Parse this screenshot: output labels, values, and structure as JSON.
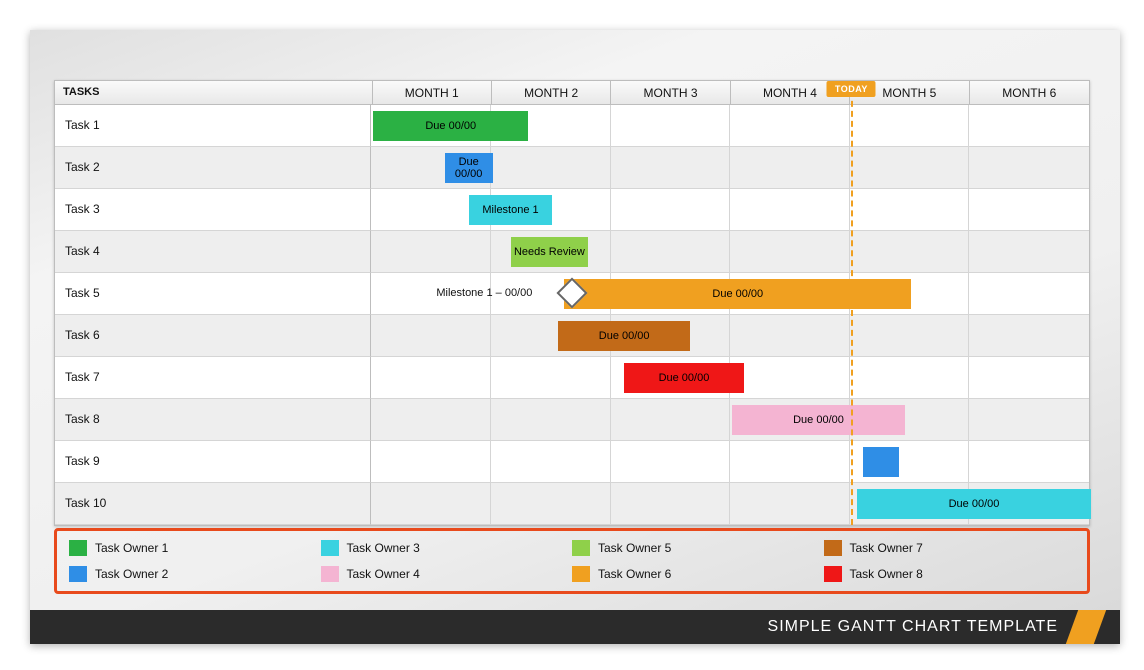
{
  "chart_data": {
    "type": "bar",
    "title": "SIMPLE GANTT CHART TEMPLATE",
    "xlabel": "",
    "ylabel": "",
    "categories": [
      "MONTH 1",
      "MONTH 2",
      "MONTH 3",
      "MONTH 4",
      "MONTH 5",
      "MONTH 6"
    ],
    "xlim": [
      0,
      6
    ],
    "today_position": 4.0,
    "today_label": "TODAY",
    "tasks_header": "TASKS",
    "tasks": [
      {
        "name": "Task 1",
        "start": 0.0,
        "end": 1.3,
        "label": "Due 00/00",
        "color": "#2bb144",
        "owner": "Task Owner 1",
        "prefix": ""
      },
      {
        "name": "Task 2",
        "start": 0.6,
        "end": 1.0,
        "label": "Due 00/00",
        "color": "#2f8ee6",
        "owner": "Task Owner 2",
        "prefix": ""
      },
      {
        "name": "Task 3",
        "start": 0.8,
        "end": 1.5,
        "label": "Milestone 1",
        "color": "#39d2e0",
        "owner": "Task Owner 3",
        "prefix": ""
      },
      {
        "name": "Task 4",
        "start": 1.15,
        "end": 1.8,
        "label": "Needs Review",
        "color": "#8fd04a",
        "owner": "Task Owner 5",
        "prefix": ""
      },
      {
        "name": "Task 5",
        "start": 1.6,
        "end": 4.5,
        "label": "Due 00/00",
        "color": "#f0a020",
        "owner": "Task Owner 6",
        "prefix": "Milestone 1 – 00/00",
        "milestone_at": 1.66
      },
      {
        "name": "Task 6",
        "start": 1.55,
        "end": 2.65,
        "label": "Due 00/00",
        "color": "#c26a18",
        "owner": "Task Owner 7",
        "prefix": ""
      },
      {
        "name": "Task 7",
        "start": 2.1,
        "end": 3.1,
        "label": "Due 00/00",
        "color": "#ef1717",
        "owner": "Task Owner 8",
        "prefix": ""
      },
      {
        "name": "Task 8",
        "start": 3.0,
        "end": 4.45,
        "label": "Due 00/00",
        "color": "#f4b4d2",
        "owner": "Task Owner 4",
        "prefix": ""
      },
      {
        "name": "Task 9",
        "start": 4.1,
        "end": 4.4,
        "label": "",
        "color": "#2f8ee6",
        "owner": "Task Owner 2",
        "prefix": ""
      },
      {
        "name": "Task 10",
        "start": 4.05,
        "end": 6.0,
        "label": "Due 00/00",
        "color": "#39d2e0",
        "owner": "Task Owner 3",
        "prefix": ""
      }
    ],
    "legend": [
      {
        "label": "Task Owner 1",
        "color": "#2bb144"
      },
      {
        "label": "Task Owner 3",
        "color": "#39d2e0"
      },
      {
        "label": "Task Owner 5",
        "color": "#8fd04a"
      },
      {
        "label": "Task Owner 7",
        "color": "#c26a18"
      },
      {
        "label": "Task Owner 2",
        "color": "#2f8ee6"
      },
      {
        "label": "Task Owner 4",
        "color": "#f4b4d2"
      },
      {
        "label": "Task Owner 6",
        "color": "#f0a020"
      },
      {
        "label": "Task Owner 8",
        "color": "#ef1717"
      }
    ]
  },
  "footer": {
    "title": "SIMPLE GANTT CHART TEMPLATE"
  }
}
